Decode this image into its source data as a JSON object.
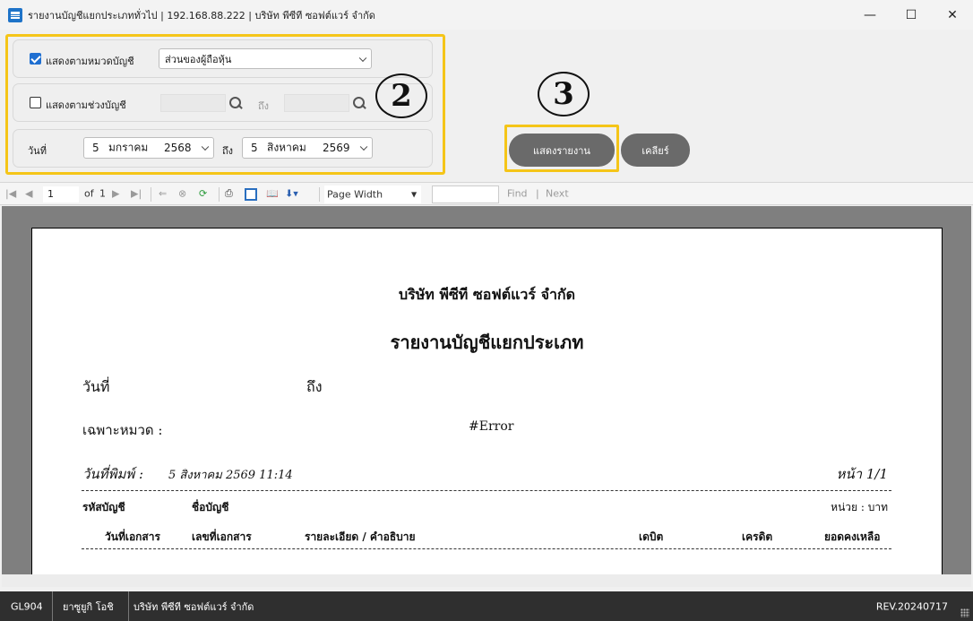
{
  "window": {
    "title": "รายงานบัญชีแยกประเภททั่วไป | 192.168.88.222 | บริษัท พีซีที ซอฟต์แวร์ จำกัด",
    "minimize": "—",
    "maximize": "☐",
    "close": "✕"
  },
  "filters": {
    "by_category": {
      "label": "แสดงตามหมวดบัญชี",
      "checked": true,
      "selected": "ส่วนของผู้ถือหุ้น"
    },
    "by_range": {
      "label": "แสดงตามช่วงบัญชี",
      "checked": false,
      "to_label": "ถึง"
    },
    "date": {
      "label": "วันที่",
      "to_label": "ถึง",
      "from": {
        "day": "5",
        "month": "มกราคม",
        "year": "2568"
      },
      "to": {
        "day": "5",
        "month": "สิงหาคม",
        "year": "2569"
      }
    }
  },
  "annotations": {
    "step2": "2",
    "step3": "3"
  },
  "buttons": {
    "show_report": "แสดงรายงาน",
    "clear": "เคลียร์"
  },
  "report_toolbar": {
    "current_page": "1",
    "of_label": "of",
    "total_pages": "1",
    "zoom": "Page Width",
    "find": "Find",
    "next": "Next",
    "separator": "|"
  },
  "report": {
    "company": "บริษัท พีซีที ซอฟต์แวร์ จำกัด",
    "title": "รายงานบัญชีแยกประเภท",
    "date_label": "วันที่",
    "to_label": "ถึง",
    "category_label": "เฉพาะหมวด :",
    "category_value": "#Error",
    "printed_label": "วันที่พิมพ์ :",
    "printed_value": "5 สิงหาคม 2569 11:14",
    "page_label": "หน้า 1/1",
    "unit_label": "หน่วย : บาท",
    "headers": {
      "account_code": "รหัสบัญชี",
      "account_name": "ชื่อบัญชี",
      "doc_date": "วันที่เอกสาร",
      "doc_no": "เลขที่เอกสาร",
      "description": "รายละเอียด / คำอธิบาย",
      "debit": "เดบิต",
      "credit": "เครดิต",
      "balance": "ยอดคงเหลือ"
    }
  },
  "statusbar": {
    "code": "GL904",
    "user": "ยาซูยูกิ  โอชิ",
    "company": "บริษัท พีซีที ซอฟต์แวร์ จำกัด",
    "revision": "REV.20240717"
  },
  "colors": {
    "highlight": "#f5c518",
    "button": "#6a6a6a",
    "statusbar": "#2f2f2f",
    "checkbox": "#1f6fd1"
  }
}
